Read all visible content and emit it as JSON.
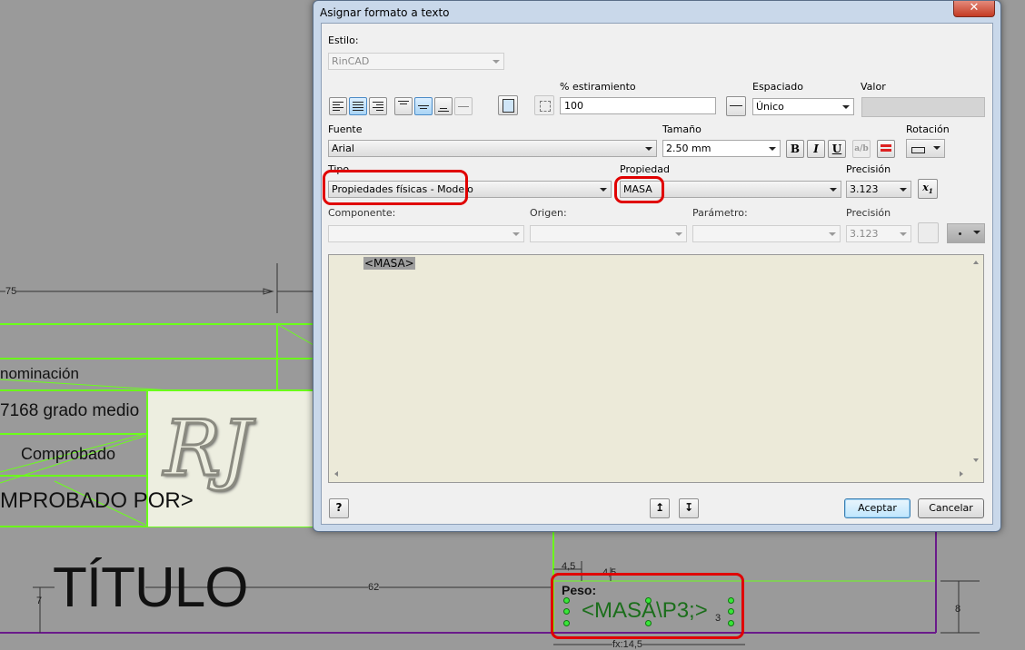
{
  "cad": {
    "denominacion": "nominación",
    "grado": "7168 grado medio",
    "comprobado": "Comprobado",
    "comprobado_por": "MPROBADO POR>",
    "titulo": "TÍTULO",
    "peso_label": "Peso:",
    "masa_field": "<MASA\\P3;>",
    "dims": {
      "d75": "75",
      "d62": "62",
      "d7": "7",
      "d45a": "4,5",
      "d45b": "4,5",
      "d8": "8",
      "d3": "3",
      "dfx": "fx:14,5"
    },
    "logo_text": "RJ"
  },
  "dialog": {
    "title": "Asignar formato a texto",
    "close": "✕",
    "estilo_label": "Estilo:",
    "estilo_value": "RinCAD",
    "estiramiento_label": "% estiramiento",
    "estiramiento_value": "100",
    "espaciado_label": "Espaciado",
    "espaciado_value": "Único",
    "valor_label": "Valor",
    "fuente_label": "Fuente",
    "fuente_value": "Arial",
    "tamano_label": "Tamaño",
    "tamano_value": "2.50 mm",
    "bold": "B",
    "italic": "I",
    "underline": "U",
    "rotacion_label": "Rotación",
    "tipo_label": "Tipo",
    "tipo_value": "Propiedades físicas - Modelo",
    "propiedad_label": "Propiedad",
    "propiedad_value": "MASA",
    "precision_label": "Precisión",
    "precision_value": "3.123",
    "componente_label": "Componente:",
    "origen_label": "Origen:",
    "parametro_label": "Parámetro:",
    "precision2_label": "Precisión",
    "precision2_value": "3.123",
    "editor_text": "<MASA>",
    "aceptar": "Aceptar",
    "cancelar": "Cancelar"
  }
}
